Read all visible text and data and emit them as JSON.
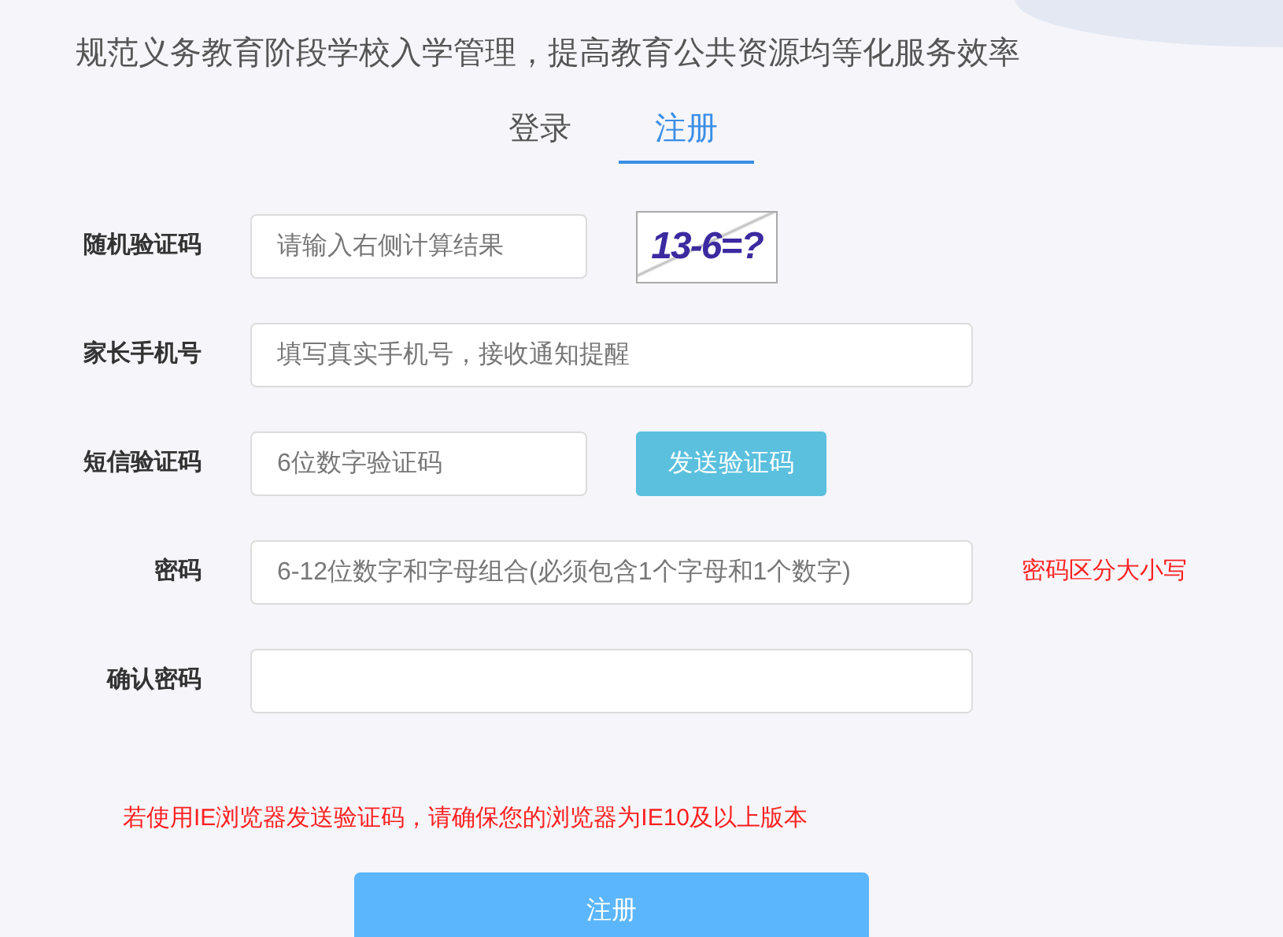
{
  "headline": "规范义务教育阶段学校入学管理，提高教育公共资源均等化服务效率",
  "tabs": [
    {
      "label": "登录",
      "selected": false
    },
    {
      "label": "注册",
      "selected": true
    }
  ],
  "fields": [
    {
      "kind": "captcha",
      "label": "随机验证码",
      "placeholder": "请输入右侧计算结果",
      "captcha": "13-6=?"
    },
    {
      "kind": "wide",
      "label": "家长手机号",
      "placeholder": "填写真实手机号，接收通知提醒"
    },
    {
      "kind": "sms",
      "label": "短信验证码",
      "placeholder": "6位数字验证码",
      "button": "发送验证码"
    },
    {
      "kind": "password",
      "label": "密码",
      "placeholder": "6-12位数字和字母组合(必须包含1个字母和1个数字)",
      "note": "密码区分大小写"
    },
    {
      "kind": "password",
      "label": "确认密码"
    }
  ],
  "warning": "若使用IE浏览器发送验证码，请确保您的浏览器为IE10及以上版本",
  "submit": "注册"
}
